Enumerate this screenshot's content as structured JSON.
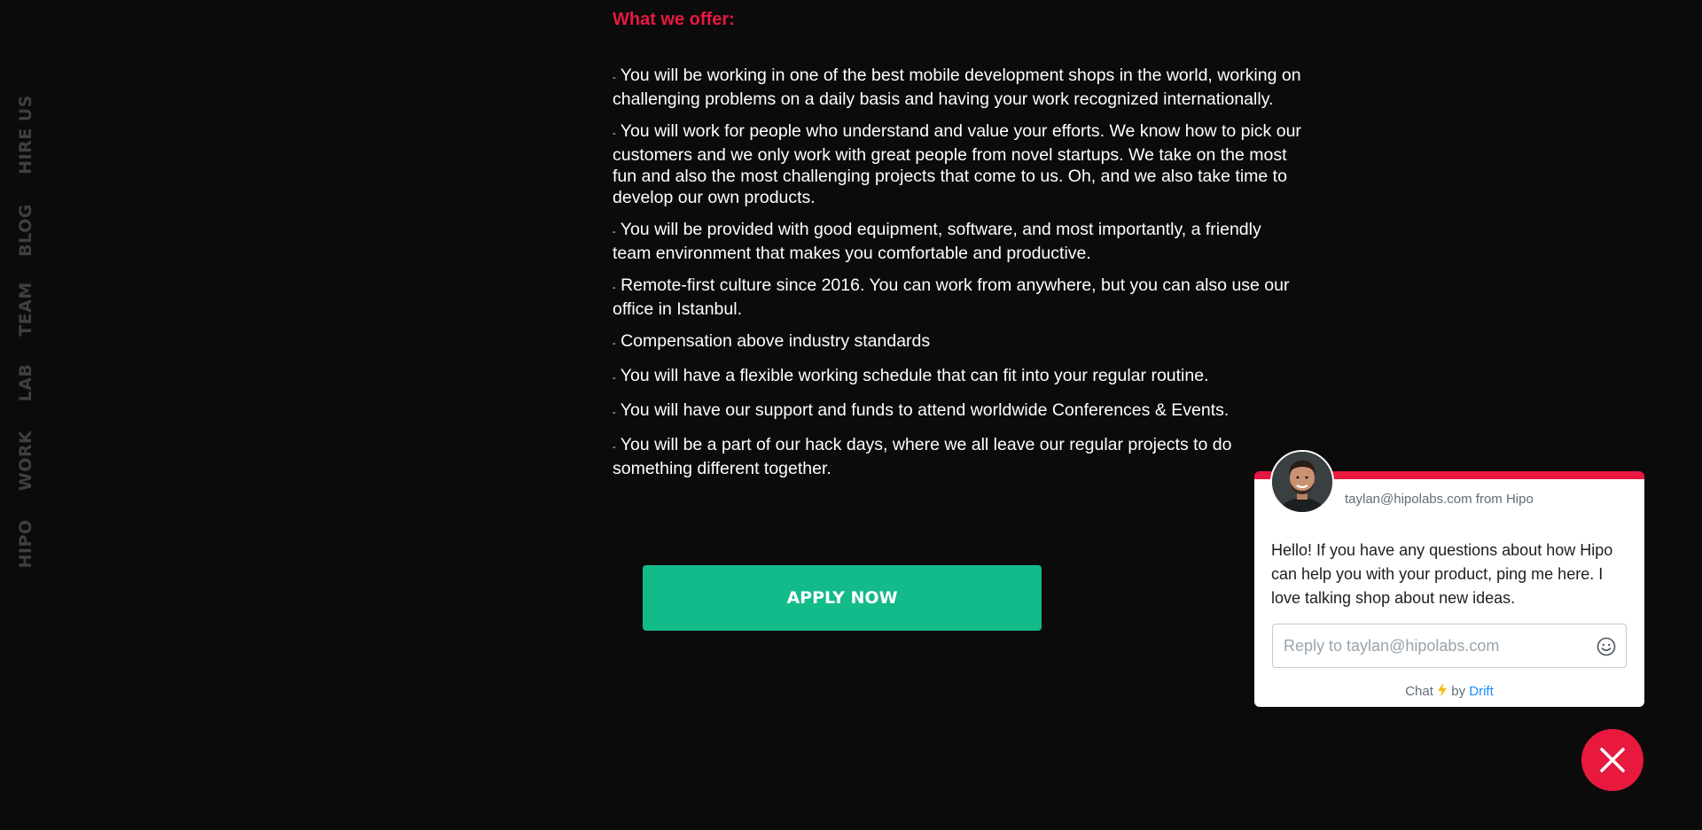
{
  "sidebar": {
    "items": [
      {
        "label": "HIRE US"
      },
      {
        "label": "BLOG"
      },
      {
        "label": "TEAM"
      },
      {
        "label": "LAB"
      },
      {
        "label": "WORK"
      },
      {
        "label": "HIPO"
      }
    ]
  },
  "offer": {
    "title": "What we offer:",
    "bullet": "-",
    "items": [
      "You will be working in one of the best mobile development shops in the world, working on challenging problems on a daily basis and having your work recognized internationally.",
      "You will work for people who understand and value your efforts. We know how to pick our customers and we only work with great people from novel startups. We take on the most fun and also the most challenging projects that come to us. Oh, and we also take time to develop our own products.",
      "You will be provided with good equipment, software, and most importantly, a friendly team environment that makes you comfortable and productive.",
      "Remote-first culture since 2016. You can work from anywhere, but you can also use our office in Istanbul.",
      "Compensation above industry standards",
      "You will have a flexible working schedule that can fit into your regular routine.",
      "You will have our support and funds to attend worldwide Conferences & Events.",
      "You will be a part of our hack days, where we all leave our regular projects to do something different together."
    ]
  },
  "apply": {
    "label": "APPLY NOW"
  },
  "chat": {
    "from": "taylan@hipolabs.com from Hipo",
    "message": "Hello! If you have any questions about how Hipo can help you with your product, ping me here. I love talking shop about new ideas.",
    "reply_placeholder": "Reply to taylan@hipolabs.com",
    "footer_chat": "Chat",
    "footer_by": "by",
    "footer_brand": "Drift"
  },
  "colors": {
    "accent": "#e8183f",
    "apply_button": "#13ba8a",
    "drift_link": "#1a8aff",
    "background": "#0b0b0b"
  },
  "icons": {
    "emoji": "smiley-icon",
    "bolt": "lightning-bolt-icon",
    "close": "close-icon"
  }
}
